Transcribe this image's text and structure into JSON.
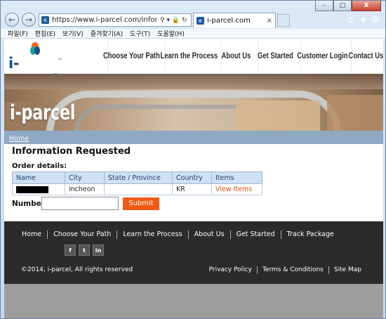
{
  "browser": {
    "url": "https://www.i-parcel.com/inforequestsec",
    "tab_title": "i-parcel.com",
    "menu": [
      "파일(F)",
      "편집(E)",
      "보기(V)",
      "즐겨찾기(A)",
      "도구(T)",
      "도움말(H)"
    ],
    "window_controls": [
      "–",
      "□",
      "X"
    ]
  },
  "site": {
    "logo_text": "i-parcel",
    "hero_title": "i-parcel",
    "nav": [
      "Choose Your Path",
      "Learn the Process",
      "About Us",
      "Get Started",
      "Customer Login",
      "Contact Us"
    ],
    "breadcrumb": "Home"
  },
  "content": {
    "title": "Information Requested",
    "order_details_label": "Order details:",
    "table": {
      "headers": [
        "Name",
        "City",
        "State / Province",
        "Country",
        "Items"
      ],
      "rows": [
        {
          "name": "",
          "city": "incheon",
          "state": "",
          "country": "KR",
          "items": "View Items"
        }
      ]
    },
    "number_label": "Number",
    "number_value": "",
    "submit_label": "Submit"
  },
  "footer": {
    "nav": [
      "Home",
      "Choose Your Path",
      "Learn the Process",
      "About Us",
      "Get Started",
      "Track Package"
    ],
    "social": [
      "f",
      "t",
      "in"
    ],
    "copyright": "©2014, i-parcel, All rights reserved",
    "links": [
      "Privacy Policy",
      "Terms & Conditions",
      "Site Map"
    ]
  }
}
